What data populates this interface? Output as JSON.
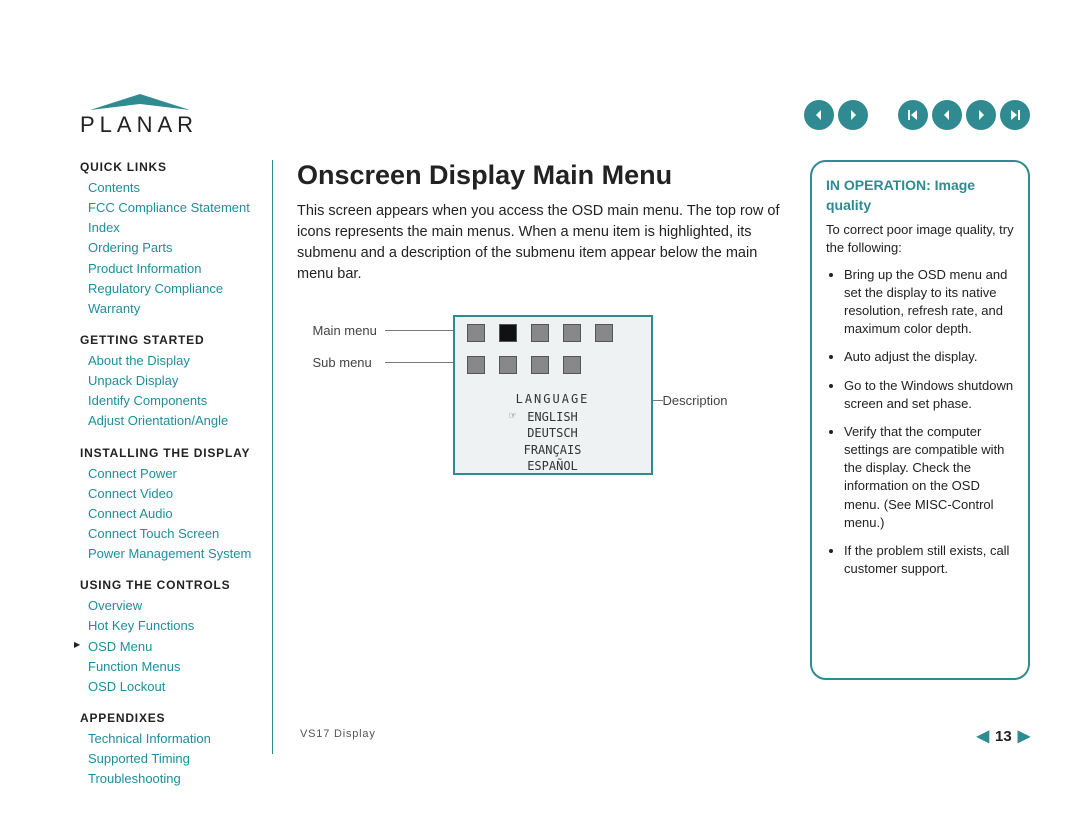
{
  "logo_text": "PLANAR",
  "nav": {
    "group1": [
      "prev-page-alt",
      "next-page-alt"
    ],
    "group2": [
      "first-page",
      "prev-page",
      "next-page",
      "last-page"
    ]
  },
  "sidebar": {
    "sections": [
      {
        "title": "QUICK LINKS",
        "items": [
          "Contents",
          "FCC Compliance Statement",
          "Index",
          "Ordering Parts",
          "Product Information",
          "Regulatory Compliance",
          "Warranty"
        ]
      },
      {
        "title": "GETTING STARTED",
        "items": [
          "About the Display",
          "Unpack Display",
          "Identify Components",
          "Adjust Orientation/Angle"
        ]
      },
      {
        "title": "INSTALLING THE DISPLAY",
        "items": [
          "Connect Power",
          "Connect Video",
          "Connect Audio",
          "Connect Touch Screen",
          "Power Management System"
        ]
      },
      {
        "title": "USING THE CONTROLS",
        "items": [
          "Overview",
          "Hot Key Functions",
          "OSD Menu",
          "Function Menus",
          "OSD Lockout"
        ],
        "current_index": 2
      },
      {
        "title": "APPENDIXES",
        "items": [
          "Technical Information",
          "Supported Timing",
          "Troubleshooting"
        ]
      }
    ]
  },
  "main": {
    "title": "Onscreen Display Main Menu",
    "intro": "This screen appears when you access the OSD main menu. The top row of icons represents the main menus. When a menu item is highlighted, its submenu and a description of the submenu item appear below the main menu bar."
  },
  "figure": {
    "label_main": "Main menu",
    "label_sub": "Sub menu",
    "label_desc": "Description",
    "lang_header": "LANGUAGE",
    "langs": [
      "ENGLISH",
      "DEUTSCH",
      "FRANÇAIS",
      "ESPAÑOL"
    ],
    "lang_selected": 0
  },
  "callout": {
    "title": "IN OPERATION: Image quality",
    "lead": "To correct poor image quality, try the following:",
    "bullets": [
      "Bring up the OSD menu and set the display to its native resolution, refresh rate, and maximum color depth.",
      "Auto adjust the display.",
      "Go to the Windows shutdown screen and set phase.",
      "Verify that the computer settings are compatible with the display. Check the information on the OSD menu. (See MISC-Control menu.)",
      "If the problem still exists, call customer support."
    ]
  },
  "footer": {
    "product": "VS17 Display",
    "page": "13"
  }
}
